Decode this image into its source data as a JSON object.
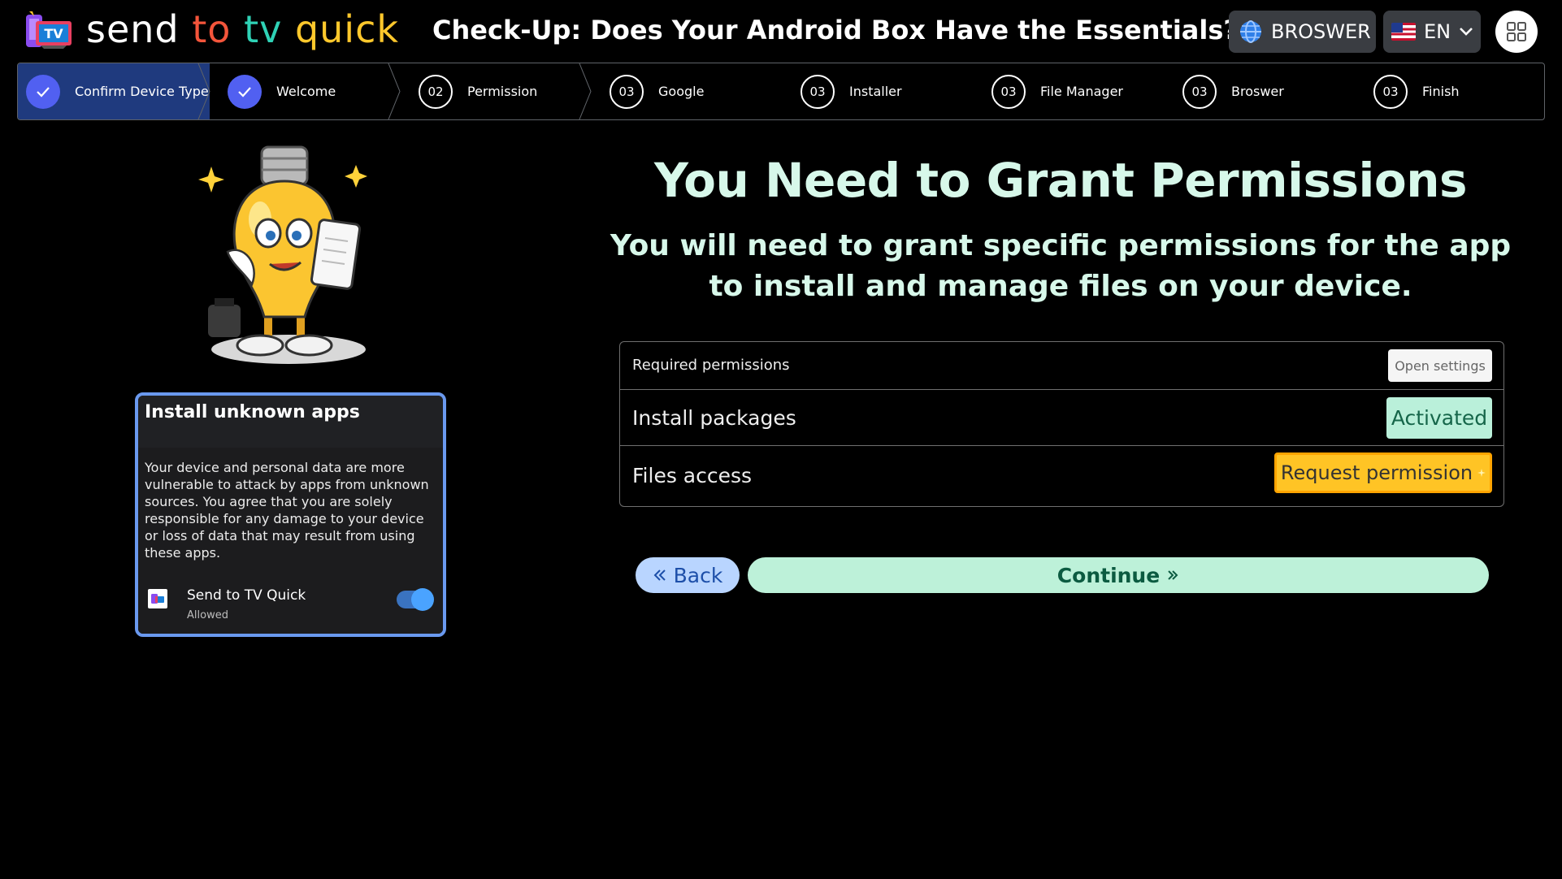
{
  "app": {
    "logo_words": [
      "send",
      "to",
      "tv",
      "quick"
    ],
    "logo_icon_text": "TV",
    "page_heading": "Check-Up: Does Your Android Box Have the Essentials?"
  },
  "header": {
    "browser_button": "BROSWER",
    "language": "EN",
    "icons": [
      "globe-icon",
      "us-flag-icon",
      "chevron-down-icon",
      "apps-grid-icon"
    ]
  },
  "steps": [
    {
      "number": "",
      "label": "Confirm Device Type",
      "state": "done"
    },
    {
      "number": "",
      "label": "Welcome",
      "state": "done"
    },
    {
      "number": "02",
      "label": "Permission",
      "state": "current"
    },
    {
      "number": "03",
      "label": "Google",
      "state": "pending"
    },
    {
      "number": "03",
      "label": "Installer",
      "state": "pending"
    },
    {
      "number": "03",
      "label": "File Manager",
      "state": "pending"
    },
    {
      "number": "03",
      "label": "Broswer",
      "state": "pending"
    },
    {
      "number": "03",
      "label": "Finish",
      "state": "pending"
    }
  ],
  "card": {
    "title": "Install unknown apps",
    "text": "Your device and personal data are more vulnerable to attack by apps from unknown sources. You agree that you are solely responsible for any damage to your device or loss of data that may result from using these apps.",
    "app_name": "Send to TV Quick",
    "app_status": "Allowed",
    "toggle_on": true
  },
  "main": {
    "title": "You Need to Grant Permissions",
    "subtitle": "You will need to grant specific permissions for the app to install and manage files on your device."
  },
  "permissions": {
    "header_label": "Required permissions",
    "open_settings": "Open settings",
    "rows": [
      {
        "label": "Install packages",
        "status": "Activated"
      },
      {
        "label": "Files access",
        "status": "Request permission"
      }
    ]
  },
  "nav": {
    "back": "Back",
    "continue": "Continue"
  },
  "colors": {
    "stepper_done_bg": "#1f3a7e",
    "step_check": "#5160f1",
    "title_mint": "#d7f8ea",
    "activated_bg": "#baf0da",
    "request_bg": "#ffc425",
    "back_bg": "#b9d5ff",
    "continue_bg": "#bdf1d9",
    "card_border": "#6a99ef"
  }
}
